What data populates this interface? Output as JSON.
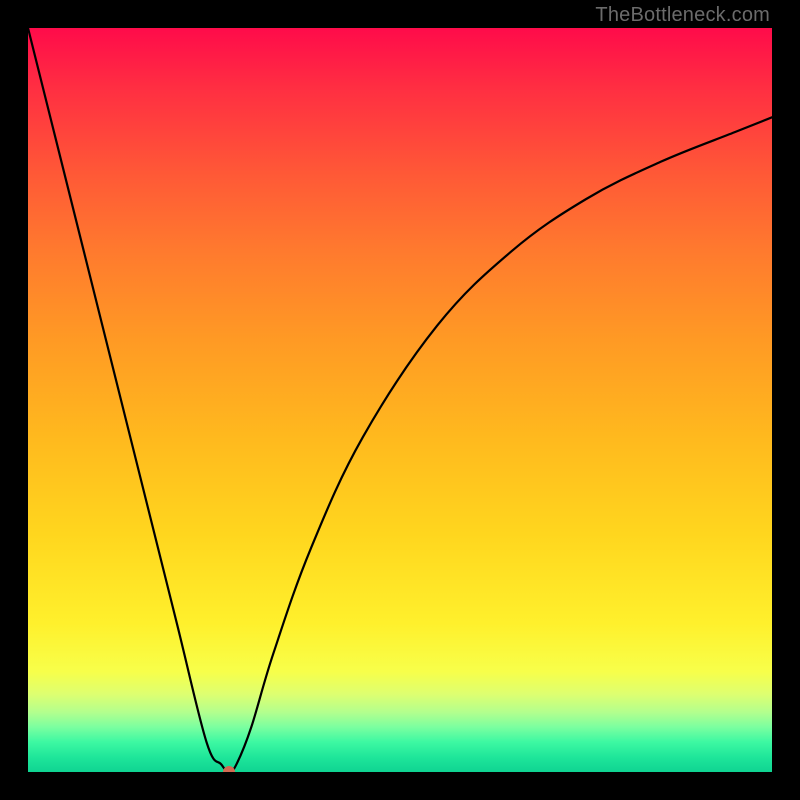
{
  "watermark": "TheBottleneck.com",
  "chart_data": {
    "type": "line",
    "title": "",
    "xlabel": "",
    "ylabel": "",
    "xlim": [
      0,
      100
    ],
    "ylim": [
      0,
      100
    ],
    "grid": false,
    "legend": false,
    "series": [
      {
        "name": "bottleneck-curve",
        "x": [
          0,
          5,
          10,
          15,
          20,
          24,
          26,
          27,
          28,
          30,
          33,
          38,
          45,
          55,
          65,
          75,
          85,
          95,
          100
        ],
        "values": [
          100,
          80,
          60,
          40,
          20,
          4,
          1,
          0,
          1,
          6,
          16,
          30,
          45,
          60,
          70,
          77,
          82,
          86,
          88
        ]
      }
    ],
    "marker": {
      "x": 27,
      "y": 0,
      "color": "#d36a52"
    },
    "background_gradient": {
      "orientation": "vertical",
      "stops": [
        {
          "pos": 0.0,
          "color": "#ff0b4a"
        },
        {
          "pos": 0.2,
          "color": "#ff5a36"
        },
        {
          "pos": 0.42,
          "color": "#ff9a24"
        },
        {
          "pos": 0.68,
          "color": "#ffd61e"
        },
        {
          "pos": 0.86,
          "color": "#f7ff4a"
        },
        {
          "pos": 0.94,
          "color": "#7affa0"
        },
        {
          "pos": 1.0,
          "color": "#0fd492"
        }
      ]
    }
  }
}
